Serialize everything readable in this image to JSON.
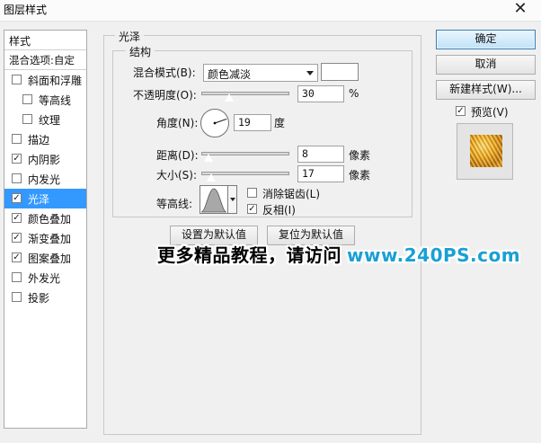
{
  "window": {
    "title": "图层样式",
    "close_glyph": "✕"
  },
  "sidebar": {
    "header": "样式",
    "blending": "混合选项:自定",
    "items": [
      {
        "label": "斜面和浮雕",
        "checked": false
      },
      {
        "label": "等高线",
        "checked": false,
        "sub": true
      },
      {
        "label": "纹理",
        "checked": false,
        "sub": true
      },
      {
        "label": "描边",
        "checked": false
      },
      {
        "label": "内阴影",
        "checked": true
      },
      {
        "label": "内发光",
        "checked": false
      },
      {
        "label": "光泽",
        "checked": true,
        "selected": true
      },
      {
        "label": "颜色叠加",
        "checked": true
      },
      {
        "label": "渐变叠加",
        "checked": true
      },
      {
        "label": "图案叠加",
        "checked": true
      },
      {
        "label": "外发光",
        "checked": false
      },
      {
        "label": "投影",
        "checked": false
      }
    ]
  },
  "panel": {
    "section_title": "光泽",
    "group_title": "结构",
    "blend_mode": {
      "label": "混合模式(B):",
      "value": "颜色减淡",
      "swatch_color": "#ffffff"
    },
    "opacity": {
      "label": "不透明度(O):",
      "value": "30",
      "unit": "%",
      "level": 30
    },
    "angle": {
      "label": "角度(N):",
      "value": "19",
      "unit": "度",
      "degrees": 19
    },
    "distance": {
      "label": "距离(D):",
      "value": "8",
      "unit": "像素",
      "level": 8
    },
    "size": {
      "label": "大小(S):",
      "value": "17",
      "unit": "像素",
      "level": 17
    },
    "contour": {
      "label": "等高线:",
      "antialias_label": "消除锯齿(L)",
      "antialias_checked": false,
      "invert_label": "反相(I)",
      "invert_checked": true
    },
    "set_default": "设置为默认值",
    "reset_default": "复位为默认值"
  },
  "right": {
    "ok": "确定",
    "cancel": "取消",
    "new_style": "新建样式(W)...",
    "preview_label": "预览(V)",
    "preview_checked": true
  },
  "watermark": {
    "part1": "更多精品教程，请访问",
    "part2": "www.240PS.com"
  }
}
